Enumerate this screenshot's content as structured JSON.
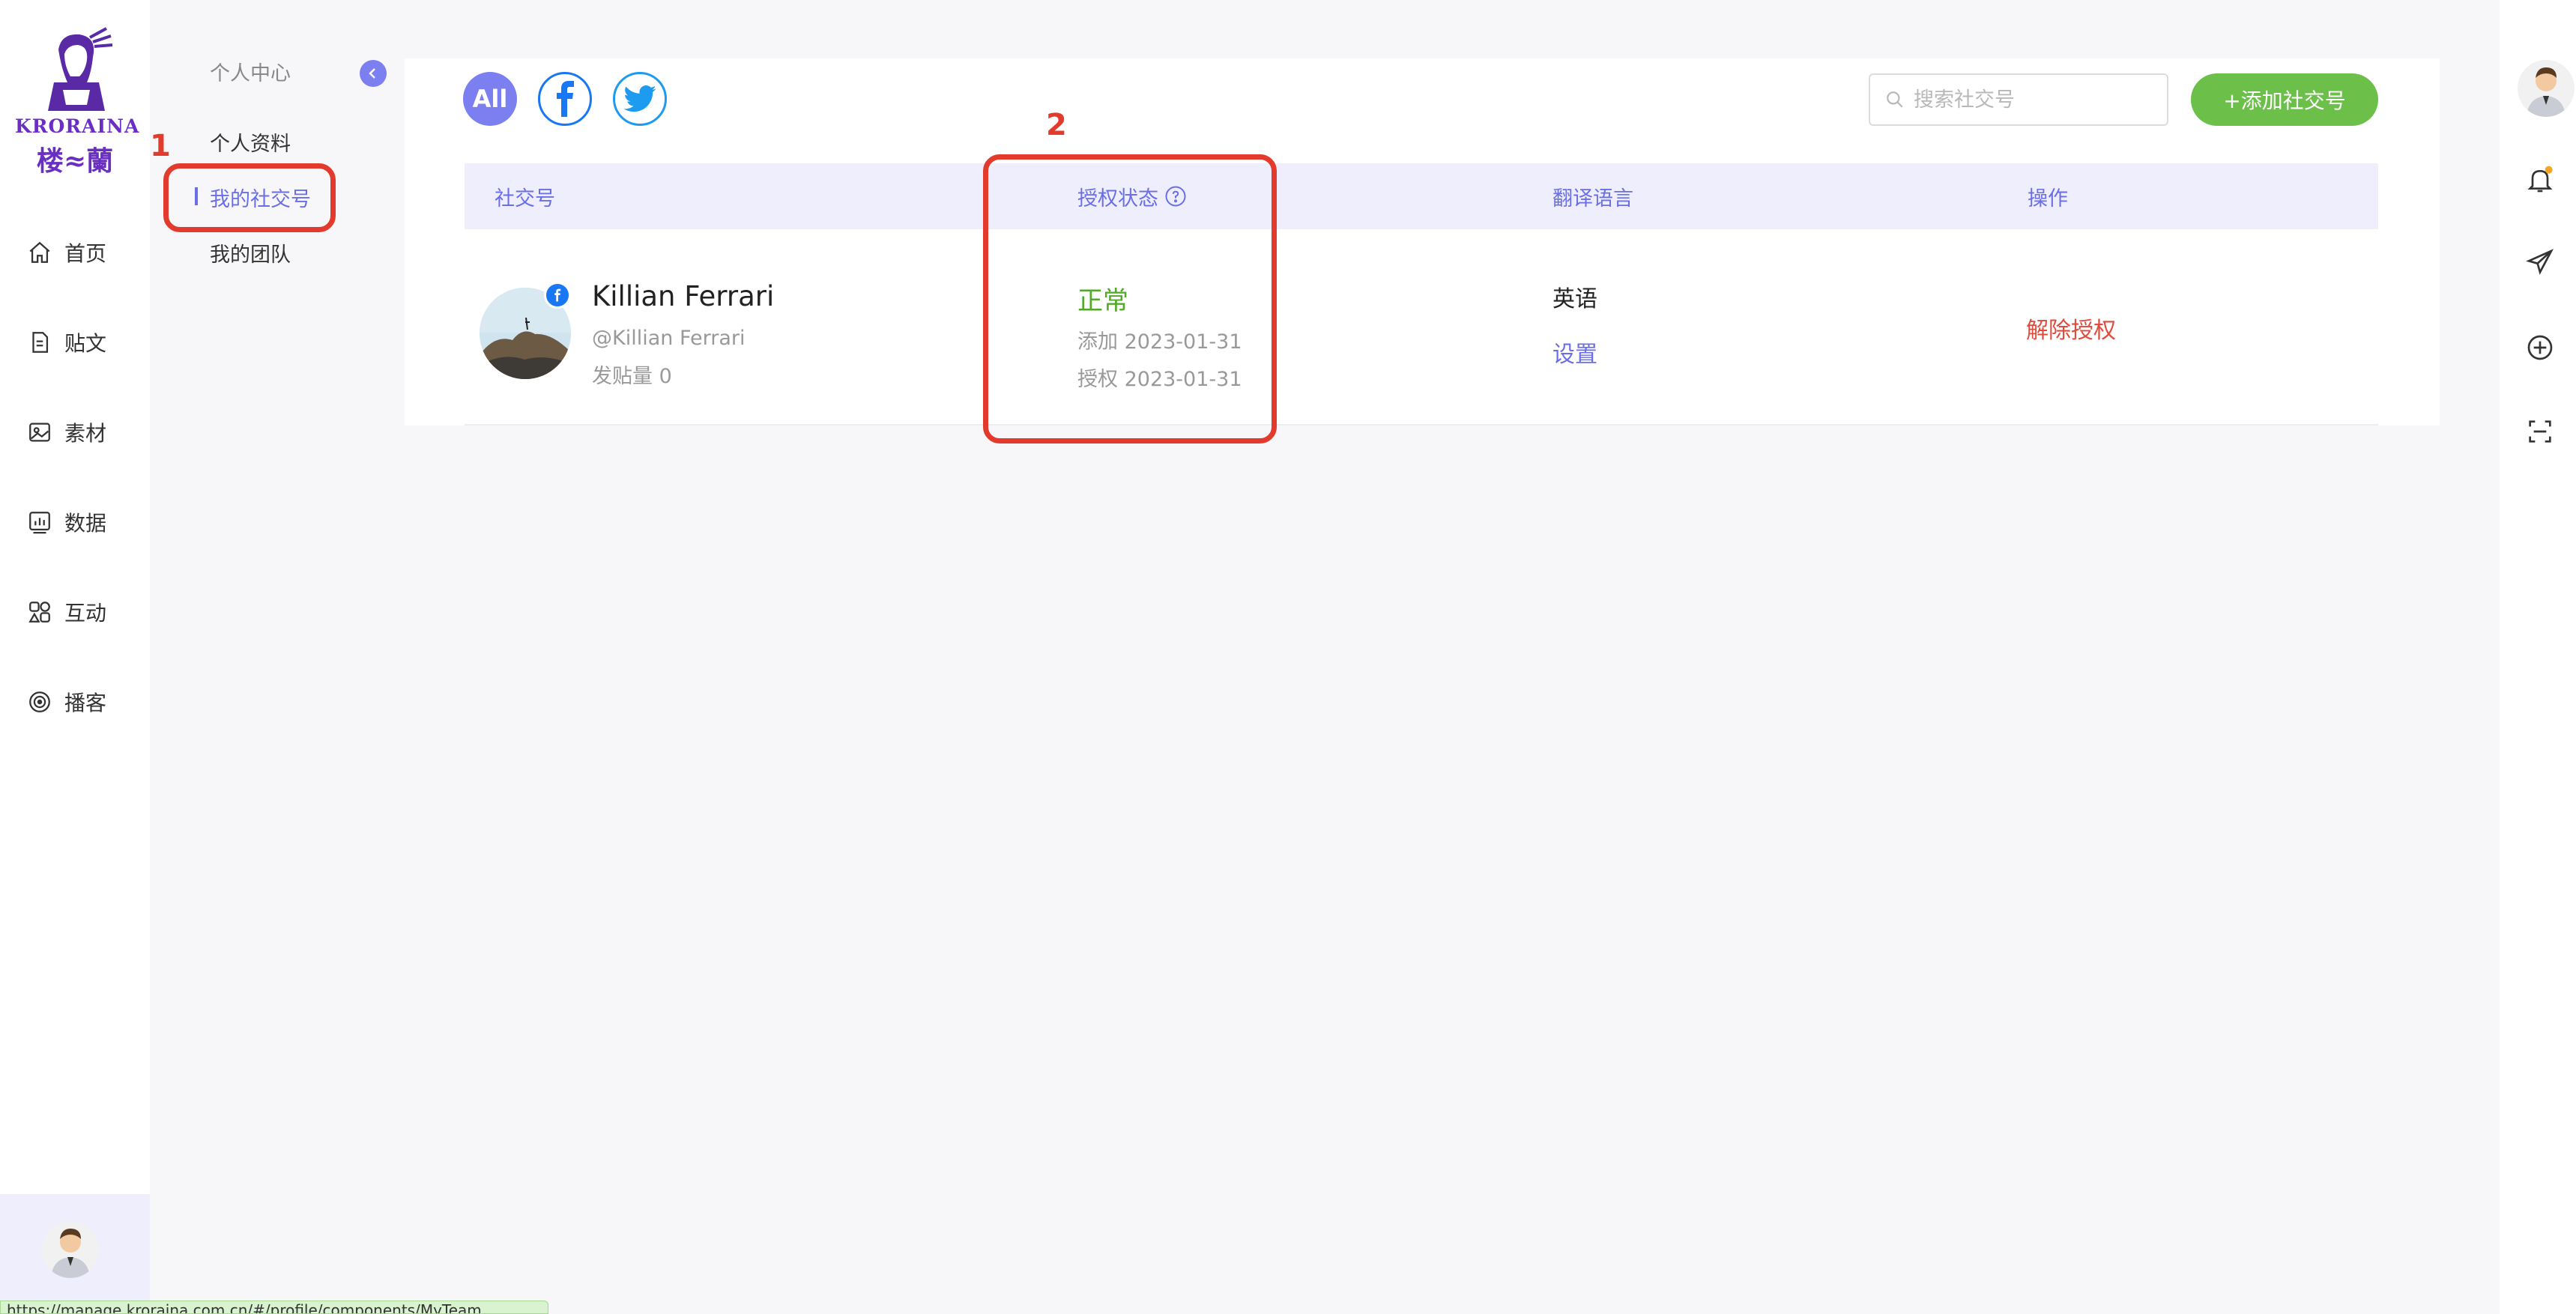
{
  "sidebar": {
    "brand": "KRORAINA",
    "brand_cn": "楼≈蘭",
    "items": [
      {
        "label": "首页",
        "icon": "home-icon"
      },
      {
        "label": "贴文",
        "icon": "document-icon"
      },
      {
        "label": "素材",
        "icon": "image-icon"
      },
      {
        "label": "数据",
        "icon": "chart-icon"
      },
      {
        "label": "互动",
        "icon": "interaction-icon"
      },
      {
        "label": "播客",
        "icon": "podcast-icon"
      }
    ]
  },
  "submenu": {
    "title": "个人中心",
    "items": [
      {
        "label": "个人资料"
      },
      {
        "label": "我的社交号",
        "active": true
      },
      {
        "label": "我的团队"
      }
    ]
  },
  "filters": {
    "all_label": "All",
    "all_color": "#7b7ff0",
    "facebook_color": "#1877f2",
    "twitter_color": "#1d9bf0"
  },
  "search": {
    "placeholder": "搜索社交号",
    "value": ""
  },
  "add_button": {
    "label": "+添加社交号",
    "color": "#6cc04a"
  },
  "table": {
    "headers": [
      "社交号",
      "授权状态",
      "翻译语言",
      "操作"
    ],
    "rows": [
      {
        "name": "Killian Ferrari",
        "handle": "@Killian Ferrari",
        "posts": "发贴量 0",
        "platform": "facebook",
        "status": "正常",
        "added": "添加 2023-01-31",
        "authorized": "授权 2023-01-31",
        "language": "英语",
        "language_action": "设置",
        "action": "解除授权"
      }
    ]
  },
  "annotations": [
    {
      "label": "1"
    },
    {
      "label": "2"
    }
  ],
  "status_bar": {
    "text": "https://manage.kroraina.com.cn/#/profile/components/MyTeam"
  },
  "colors": {
    "accent": "#6a6ee8",
    "status_ok": "#52a829",
    "danger": "#e04b3c",
    "annotation": "#e23b2e"
  }
}
